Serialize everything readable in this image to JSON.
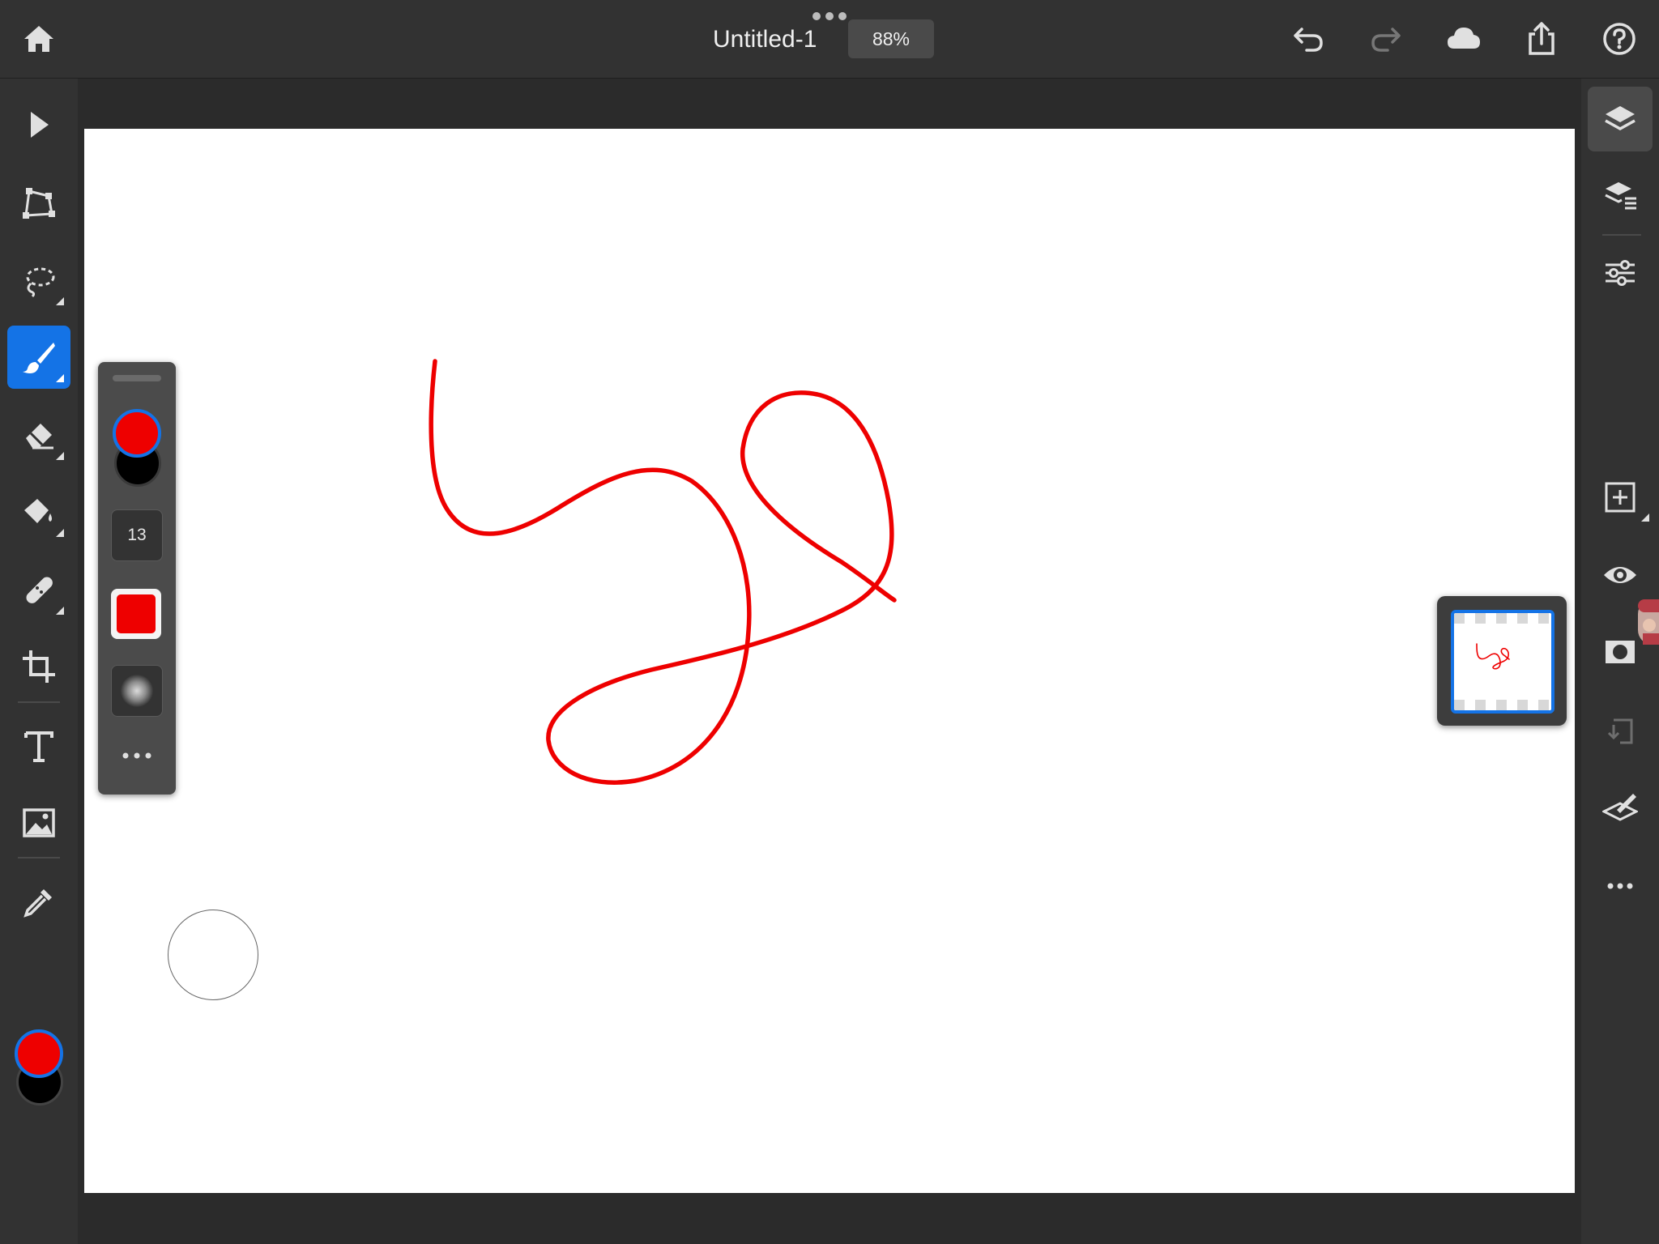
{
  "app": {
    "document_title": "Untitled-1",
    "zoom_level": "88%"
  },
  "topbar": {
    "left_icons": [
      "home-icon"
    ],
    "right_icons": [
      "undo-icon",
      "redo-icon",
      "cloud-icon",
      "share-icon",
      "help-icon"
    ],
    "redo_enabled": false
  },
  "left_toolbar": {
    "tools": [
      {
        "name": "select",
        "icon": "arrow-pointer-icon",
        "active": false,
        "has_submenu": false
      },
      {
        "name": "transform",
        "icon": "transform-icon",
        "active": false,
        "has_submenu": false
      },
      {
        "name": "lasso",
        "icon": "lasso-icon",
        "active": false,
        "has_submenu": true
      },
      {
        "name": "brush",
        "icon": "brush-icon",
        "active": true,
        "has_submenu": true
      },
      {
        "name": "eraser",
        "icon": "eraser-icon",
        "active": false,
        "has_submenu": true
      },
      {
        "name": "fill",
        "icon": "paint-bucket-icon",
        "active": false,
        "has_submenu": true
      },
      {
        "name": "healing",
        "icon": "bandage-icon",
        "active": false,
        "has_submenu": true
      },
      {
        "name": "crop",
        "icon": "crop-icon",
        "active": false,
        "has_submenu": false
      },
      {
        "name": "type",
        "icon": "type-icon",
        "active": false,
        "has_submenu": false
      },
      {
        "name": "place-image",
        "icon": "image-icon",
        "active": false,
        "has_submenu": false
      },
      {
        "name": "eyedropper",
        "icon": "eyedropper-icon",
        "active": false,
        "has_submenu": false
      }
    ],
    "foreground_color": "#ee0000",
    "background_color": "#000000"
  },
  "brush_panel": {
    "foreground_color": "#ee0000",
    "background_color": "#000000",
    "brush_size": "13",
    "brush_color": "#ee0000"
  },
  "right_toolbar": {
    "tools": [
      {
        "name": "layers",
        "icon": "layers-icon",
        "active": true
      },
      {
        "name": "layer-properties",
        "icon": "layer-properties-icon",
        "active": false
      },
      {
        "name": "adjustments",
        "icon": "sliders-icon",
        "active": false
      },
      {
        "name": "add-layer",
        "icon": "add-layer-icon",
        "active": false
      },
      {
        "name": "visibility",
        "icon": "eye-icon",
        "active": false
      },
      {
        "name": "mask",
        "icon": "mask-icon",
        "active": false
      },
      {
        "name": "merge-down",
        "icon": "merge-down-icon",
        "active": false
      },
      {
        "name": "clear-layer",
        "icon": "clear-layer-icon",
        "active": false
      },
      {
        "name": "more",
        "icon": "more-icon",
        "active": false
      }
    ]
  },
  "canvas": {
    "background": "#ffffff",
    "stroke_color": "#ee0000"
  },
  "colors": {
    "accent": "#1473e6",
    "toolbar_bg": "#323232",
    "panel_bg": "#4b4b4b"
  }
}
